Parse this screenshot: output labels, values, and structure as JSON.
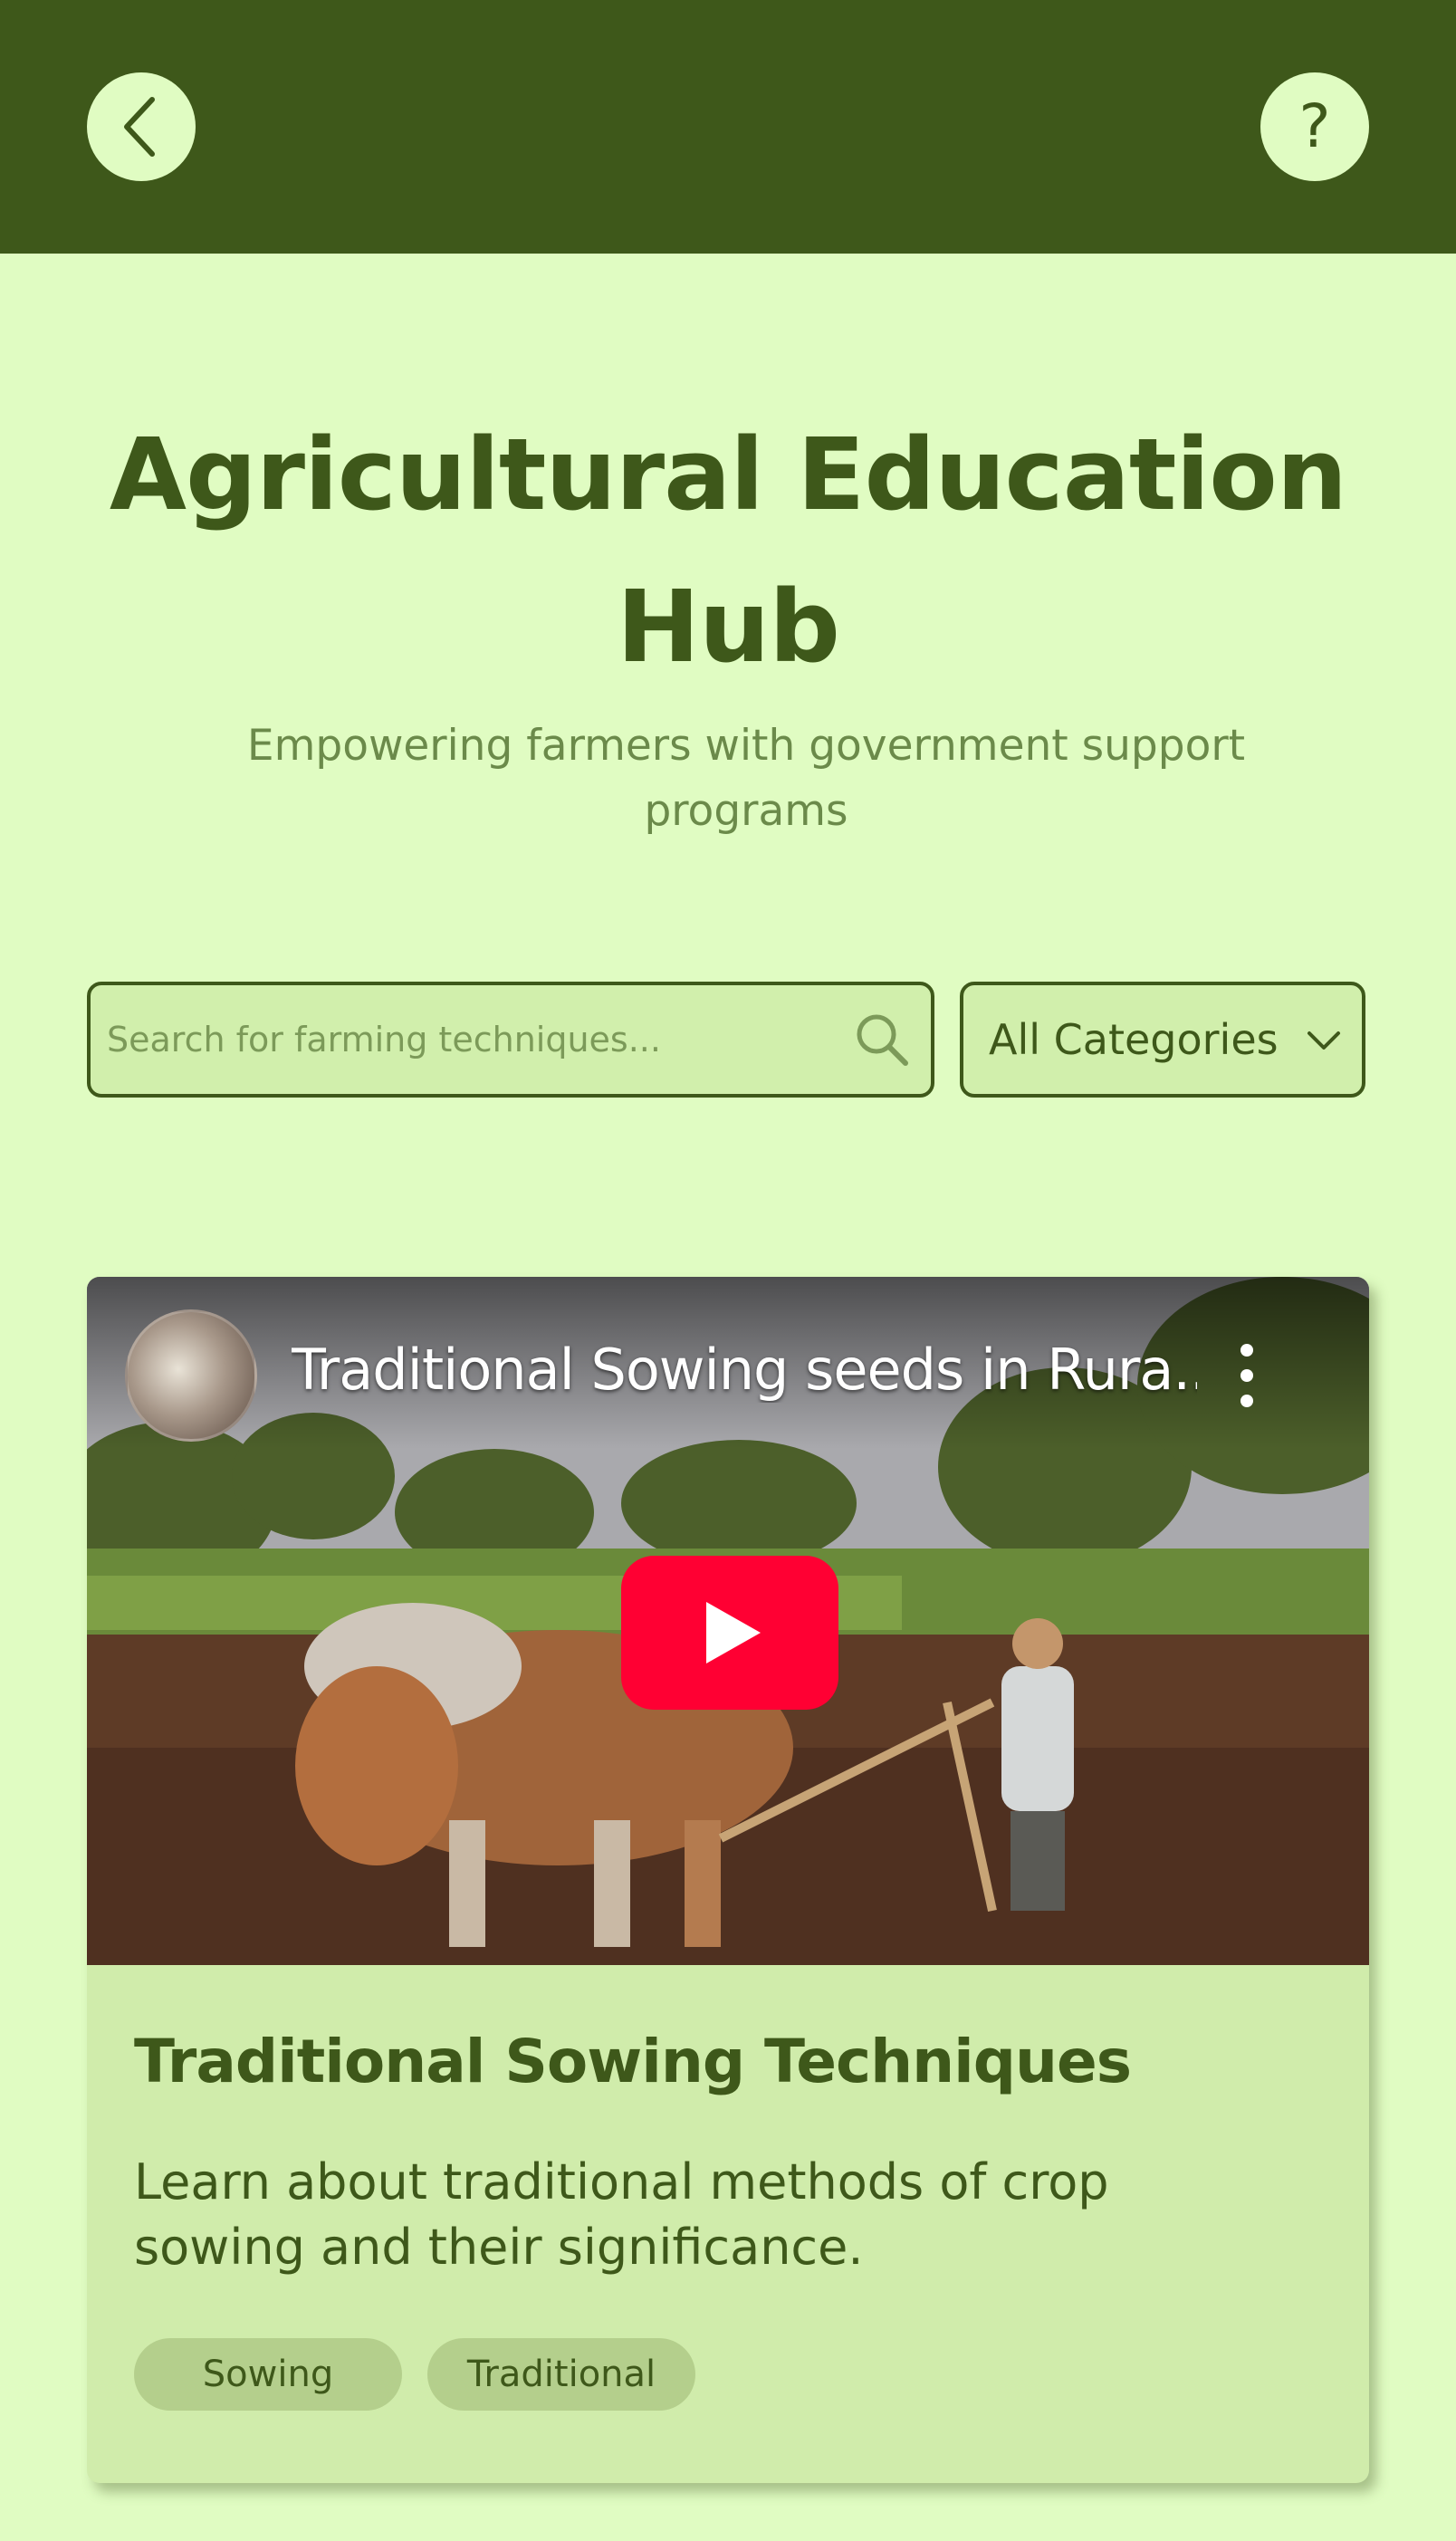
{
  "colors": {
    "header_bg": "#3e581a",
    "page_bg": "#e0fcc2",
    "accent_text": "#3e581a",
    "muted_text": "#6b8a4a",
    "card_bg": "#d0ecab",
    "tag_bg": "#b4cf8c",
    "play_red": "#ff0033"
  },
  "header": {
    "back_icon": "chevron-left-icon",
    "help_icon": "question-mark-icon",
    "help_glyph": "?"
  },
  "page": {
    "title": "Agricultural Education Hub",
    "subtitle": "Empowering farmers with government support programs"
  },
  "search": {
    "placeholder": "Search for farming techniques...",
    "value": "",
    "icon": "search-icon"
  },
  "category_filter": {
    "selected": "All Categories",
    "icon": "chevron-down-icon"
  },
  "card": {
    "video": {
      "title": "Traditional Sowing seeds in Rura...",
      "menu_icon": "more-vertical-icon",
      "play_icon": "play-icon"
    },
    "title": "Traditional Sowing Techniques",
    "description": "Learn about traditional methods of crop sowing and their significance.",
    "tags": [
      "Sowing",
      "Traditional"
    ]
  }
}
